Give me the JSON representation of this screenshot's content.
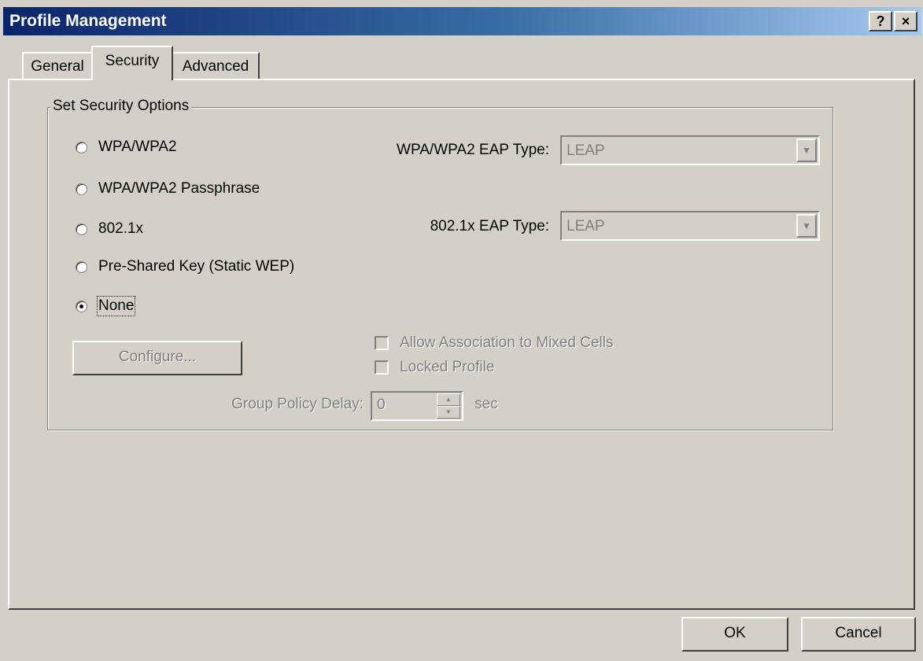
{
  "window": {
    "title": "Profile Management",
    "help_label": "?",
    "close_label": "×"
  },
  "tabs": [
    {
      "label": "General"
    },
    {
      "label": "Security"
    },
    {
      "label": "Advanced"
    }
  ],
  "security": {
    "group_title": "Set Security Options",
    "options": [
      {
        "label": "WPA/WPA2",
        "selected": false
      },
      {
        "label": "WPA/WPA2 Passphrase",
        "selected": false
      },
      {
        "label": "802.1x",
        "selected": false
      },
      {
        "label": "Pre-Shared Key (Static WEP)",
        "selected": false
      },
      {
        "label": "None",
        "selected": true
      }
    ],
    "wpa_eap_label": "WPA/WPA2 EAP Type:",
    "wpa_eap_value": "LEAP",
    "dot1x_eap_label": "802.1x EAP Type:",
    "dot1x_eap_value": "LEAP",
    "configure_label": "Configure...",
    "allow_mixed_label": "Allow Association to Mixed Cells",
    "locked_profile_label": "Locked Profile",
    "group_policy_label": "Group Policy Delay:",
    "group_policy_value": "0",
    "group_policy_unit": "sec"
  },
  "footer": {
    "ok_label": "OK",
    "cancel_label": "Cancel"
  }
}
